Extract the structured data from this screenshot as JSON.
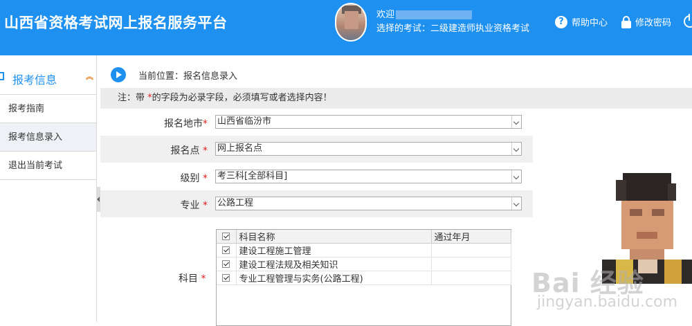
{
  "header": {
    "site_title": "山西省资格考试网上报名服务平台",
    "welcome": "欢迎",
    "exam_line": "选择的考试：二级建造师执业资格考试",
    "help_label": "帮助中心",
    "password_label": "修改密码",
    "accent_color": "#1e90f0"
  },
  "sidebar": {
    "section_title": "报考信息",
    "items": [
      {
        "label": "报考指南"
      },
      {
        "label": "报考信息录入"
      },
      {
        "label": "退出当前考试"
      }
    ]
  },
  "breadcrumb": {
    "text": "当前位置：报名信息录入"
  },
  "notice": {
    "prefix": "注：带 ",
    "star": "*",
    "suffix": "的字段为必录字段，必须填写或者选择内容！"
  },
  "form": {
    "city": {
      "label": "报名地市",
      "value": "山西省临汾市"
    },
    "site": {
      "label": "报名点",
      "value": "网上报名点"
    },
    "level": {
      "label": "级别",
      "value": "考三科[全部科目]"
    },
    "major": {
      "label": "专业",
      "value": "公路工程"
    },
    "subjects": {
      "label": "科目",
      "columns": [
        "科目名称",
        "通过年月"
      ],
      "rows": [
        {
          "name": "建设工程施工管理",
          "passed": ""
        },
        {
          "name": "建设工程法规及相关知识",
          "passed": ""
        },
        {
          "name": "专业工程管理与实务(公路工程)",
          "passed": ""
        }
      ]
    },
    "required_mark": "*"
  },
  "watermark": {
    "main": "Bai 经验",
    "sub": "jingyan.baidu.com"
  }
}
